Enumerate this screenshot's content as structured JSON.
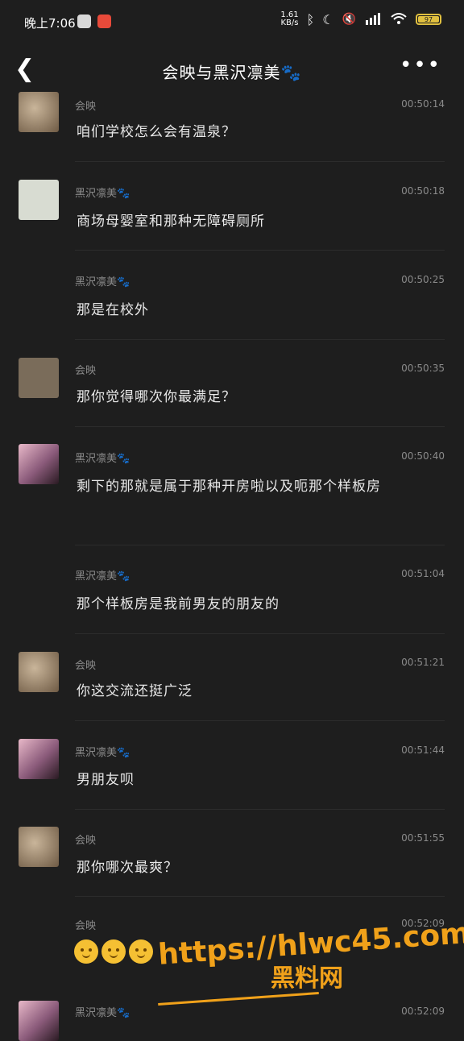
{
  "status_bar": {
    "time": "晚上7:06",
    "net_speed": "1.61",
    "net_unit": "KB/s",
    "battery": "97"
  },
  "header": {
    "title": "会映与黑沢凛美🐾"
  },
  "messages": [
    {
      "name": "会映",
      "time": "00:50:14",
      "text": "咱们学校怎么会有温泉？",
      "avatar": "cat"
    },
    {
      "name": "黑沢凛美🐾",
      "time": "00:50:18",
      "text": "商场母婴室和那种无障碍厕所",
      "avatar": "plain-light"
    },
    {
      "name": "黑沢凛美🐾",
      "time": "00:50:25",
      "text": "那是在校外",
      "avatar": "none"
    },
    {
      "name": "会映",
      "time": "00:50:35",
      "text": "那你觉得哪次你最满足？",
      "avatar": "plain-brown"
    },
    {
      "name": "黑沢凛美🐾",
      "time": "00:50:40",
      "text": "剩下的那就是属于那种开房啦以及呃那个样板房",
      "avatar": "pink"
    },
    {
      "name": "黑沢凛美🐾",
      "time": "00:51:04",
      "text": "那个样板房是我前男友的朋友的",
      "avatar": "none"
    },
    {
      "name": "会映",
      "time": "00:51:21",
      "text": "你这交流还挺广泛",
      "avatar": "cat"
    },
    {
      "name": "黑沢凛美🐾",
      "time": "00:51:44",
      "text": "男朋友呗",
      "avatar": "pink"
    },
    {
      "name": "会映",
      "time": "00:51:55",
      "text": "那你哪次最爽？",
      "avatar": "cat"
    },
    {
      "name": "会映",
      "time": "00:52:09",
      "text": "",
      "avatar": "none"
    },
    {
      "name": "黑沢凛美🐾",
      "time": "00:52:09",
      "text": "",
      "avatar": "pink"
    }
  ],
  "watermark": {
    "url": "https://hlwc45.com",
    "name": "黑料网"
  },
  "colors": {
    "background": "#1e1e1e",
    "watermark": "#f0a11a"
  }
}
